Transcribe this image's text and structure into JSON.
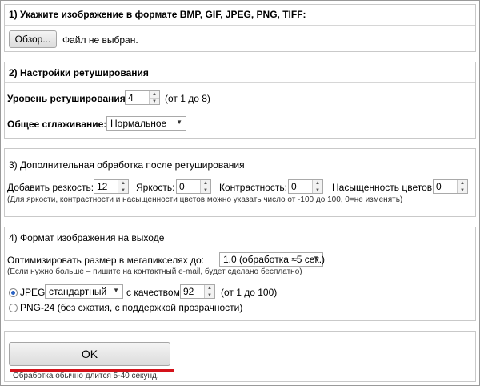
{
  "section1": {
    "title": "1) Укажите изображение в формате BMP, GIF, JPEG, PNG, TIFF:",
    "browse_label": "Обзор...",
    "file_status": "Файл не выбран."
  },
  "section2": {
    "title": "2) Настройки ретуширования",
    "level_label": "Уровень ретуширования:",
    "level_value": "4",
    "level_range": "(от 1 до 8)",
    "smoothing_label": "Общее сглаживание:",
    "smoothing_value": "Нормальное"
  },
  "section3": {
    "title": "3) Дополнительная обработка после ретуширования",
    "sharpness_label": "Добавить резкость:",
    "sharpness_value": "12",
    "brightness_label": "Яркость:",
    "brightness_value": "0",
    "contrast_label": "Контрастность:",
    "contrast_value": "0",
    "saturation_label": "Насыщенность цветов:",
    "saturation_value": "0",
    "hint": "(Для яркости, контрастности и насыщенности цветов можно указать число от -100 до 100, 0=не изменять)"
  },
  "section4": {
    "title": "4) Формат изображения на выходе",
    "optimize_label": "Оптимизировать размер в мегапикселях до:",
    "optimize_value": "1.0 (обработка ≈5 сек.)",
    "optimize_hint": "(Если нужно больше – пишите на контактный e-mail, будет сделано бесплатно)",
    "jpeg_label": "JPEG",
    "jpeg_mode": "стандартный",
    "quality_label": "с качеством",
    "quality_value": "92",
    "quality_range": "(от 1 до 100)",
    "png_label": "PNG-24 (без сжатия, с поддержкой прозрачности)"
  },
  "submit": {
    "ok_label": "OK",
    "duration_note": "Обработка обычно длится 5-40 секунд."
  },
  "colors": {
    "underline": "#d4121a",
    "radio_dot": "#2a63c4"
  }
}
